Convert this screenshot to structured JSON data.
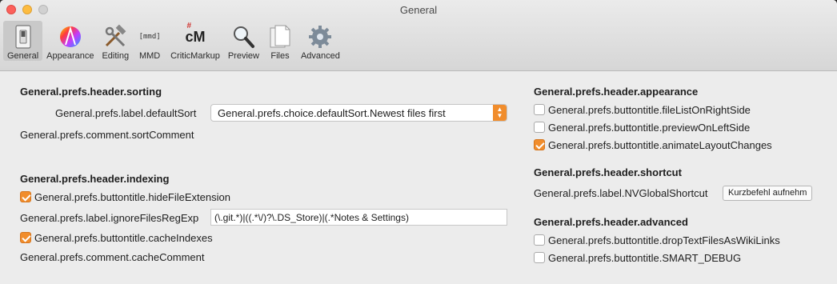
{
  "window": {
    "title": "General"
  },
  "toolbar": {
    "items": [
      {
        "label": "General",
        "icon": "switch-icon",
        "active": true
      },
      {
        "label": "Appearance",
        "icon": "color-wheel-icon"
      },
      {
        "label": "Editing",
        "icon": "tools-icon"
      },
      {
        "label": "MMD",
        "icon": "mmd-icon",
        "icon_text": "[mmd]"
      },
      {
        "label": "CriticMarkup",
        "icon": "criticmarkup-icon",
        "icon_text": "cM"
      },
      {
        "label": "Preview",
        "icon": "magnifier-icon"
      },
      {
        "label": "Files",
        "icon": "files-icon"
      },
      {
        "label": "Advanced",
        "icon": "gear-icon"
      }
    ]
  },
  "sorting": {
    "header": "General.prefs.header.sorting",
    "default_sort_label": "General.prefs.label.defaultSort",
    "default_sort_value": "General.prefs.choice.defaultSort.Newest files first",
    "comment": "General.prefs.comment.sortComment"
  },
  "indexing": {
    "header": "General.prefs.header.indexing",
    "hide_ext_label": "General.prefs.buttontitle.hideFileExtension",
    "hide_ext_checked": true,
    "ignore_label": "General.prefs.label.ignoreFilesRegExp",
    "ignore_value": "(\\.git.*)|((.*\\/)?\\.DS_Store)|(.*Notes & Settings)",
    "cache_label": "General.prefs.buttontitle.cacheIndexes",
    "cache_checked": true,
    "cache_comment": "General.prefs.comment.cacheComment"
  },
  "appearance": {
    "header": "General.prefs.header.appearance",
    "file_list_right_label": "General.prefs.buttontitle.fileListOnRightSide",
    "preview_left_label": "General.prefs.buttontitle.previewOnLeftSide",
    "animate_label": "General.prefs.buttontitle.animateLayoutChanges",
    "file_list_right_checked": false,
    "preview_left_checked": false,
    "animate_checked": true
  },
  "shortcut": {
    "header": "General.prefs.header.shortcut",
    "label": "General.prefs.label.NVGlobalShortcut",
    "button": "Kurzbefehl aufnehm"
  },
  "advanced": {
    "header": "General.prefs.header.advanced",
    "drop_label": "General.prefs.buttontitle.dropTextFilesAsWikiLinks",
    "debug_label": "General.prefs.buttontitle.SMART_DEBUG",
    "drop_checked": false,
    "debug_checked": false
  },
  "colors": {
    "accent": "#f18d2c",
    "window_bg": "#ececec"
  }
}
